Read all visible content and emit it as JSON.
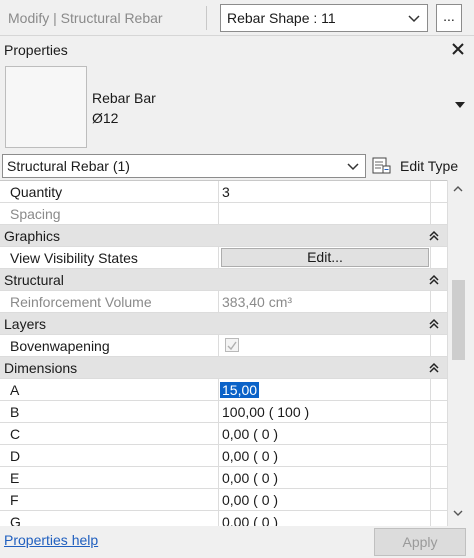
{
  "topbar": {
    "modify_label": "Modify | Structural Rebar",
    "shape_selector_value": "Rebar Shape : 11",
    "more_button_label": "..."
  },
  "properties": {
    "title": "Properties",
    "type_name_line1": "Rebar Bar",
    "type_name_line2": "Ø12",
    "instance_filter": "Structural Rebar (1)",
    "edit_type_label": "Edit Type"
  },
  "grid": {
    "quantity": {
      "name": "Quantity",
      "value": "3"
    },
    "spacing": {
      "name": "Spacing",
      "value": ""
    },
    "graphics_group": "Graphics",
    "view_visibility": {
      "name": "View Visibility States",
      "button": "Edit..."
    },
    "structural_group": "Structural",
    "reinforcement_volume": {
      "name": "Reinforcement Volume",
      "value": "383,40 cm³"
    },
    "layers_group": "Layers",
    "bovenwapening": {
      "name": "Bovenwapening",
      "checked": true
    },
    "dimensions_group": "Dimensions",
    "dims": [
      {
        "name": "A",
        "value": "15,00"
      },
      {
        "name": "B",
        "value": "100,00 ( 100 )"
      },
      {
        "name": "C",
        "value": "0,00 ( 0 )"
      },
      {
        "name": "D",
        "value": "0,00 ( 0 )"
      },
      {
        "name": "E",
        "value": "0,00 ( 0 )"
      },
      {
        "name": "F",
        "value": "0,00 ( 0 )"
      },
      {
        "name": "G",
        "value": "0,00 ( 0 )"
      }
    ]
  },
  "footer": {
    "help_link": "Properties help",
    "apply_label": "Apply"
  },
  "colors": {
    "selection": "#0a62c8",
    "link": "#1f5fbf",
    "group_header": "#e3e3e3"
  }
}
